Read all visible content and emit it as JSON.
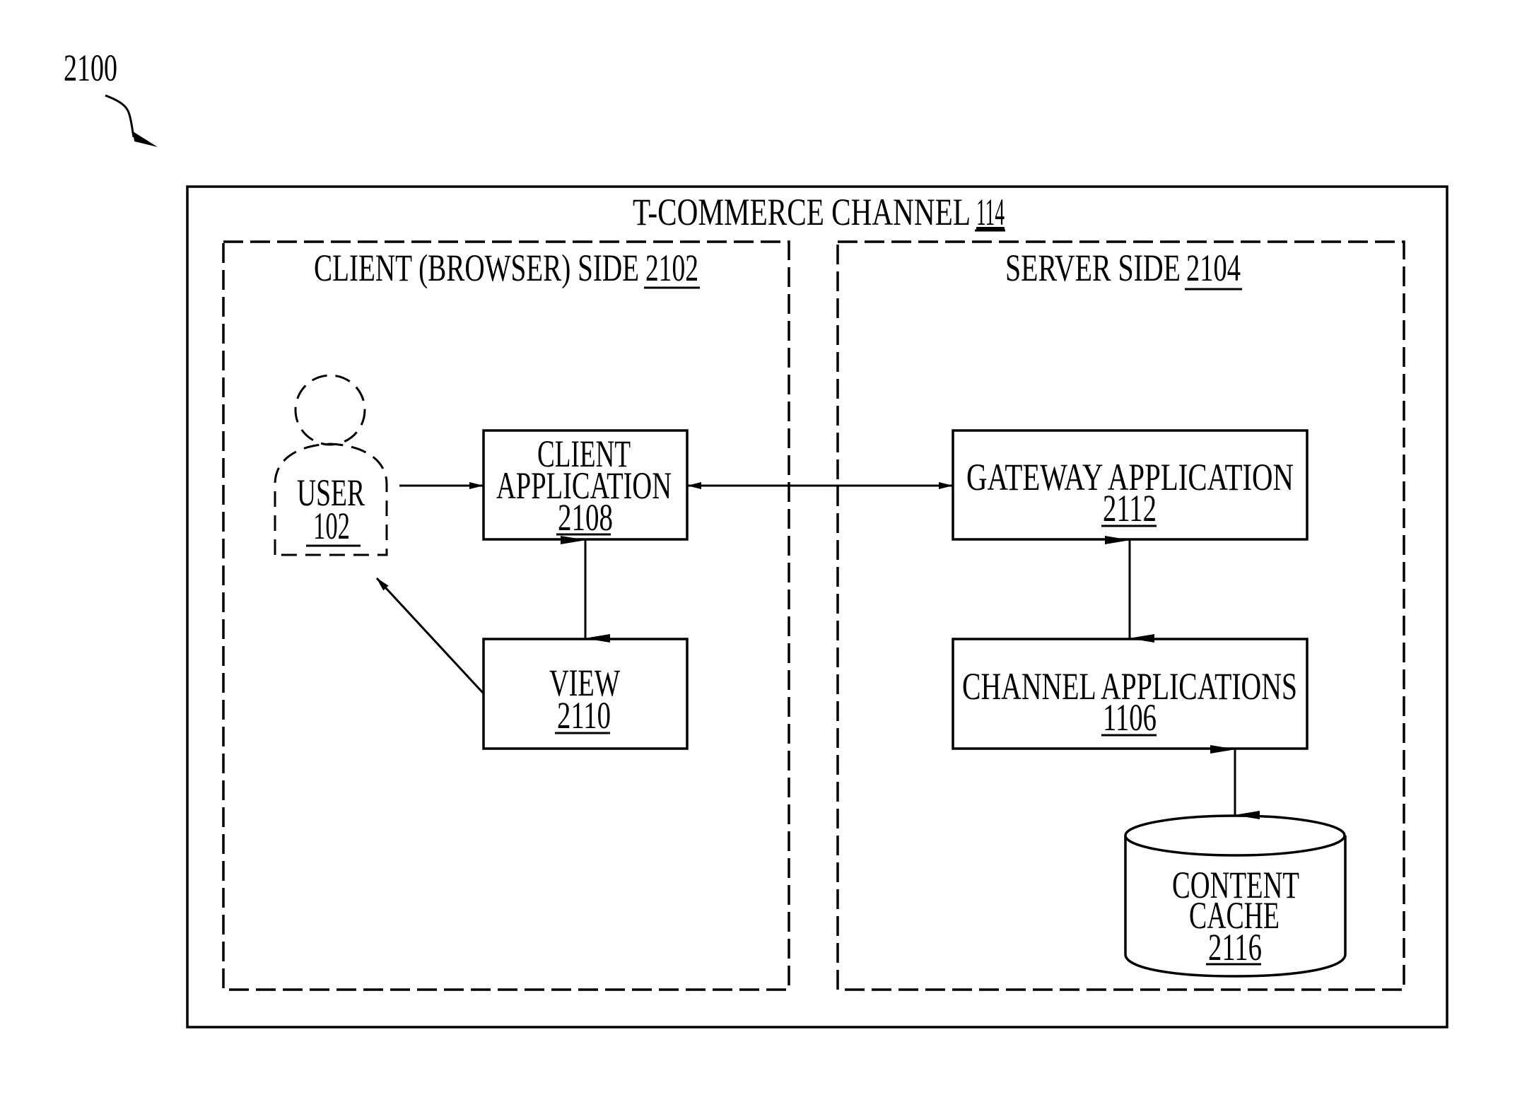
{
  "figure": {
    "ref_number": "2100",
    "ink_color": "#000000",
    "background_color": "#ffffff"
  },
  "channel": {
    "title": "T-COMMERCE CHANNEL",
    "ref": "114"
  },
  "client_side": {
    "title": "CLIENT (BROWSER) SIDE",
    "ref": "2102",
    "user": {
      "label": "USER",
      "ref": "102",
      "icon": "person-icon"
    },
    "client_application": {
      "line1": "CLIENT",
      "line2": "APPLICATION",
      "ref": "2108"
    },
    "view": {
      "label": "VIEW",
      "ref": "2110"
    }
  },
  "server_side": {
    "title": "SERVER SIDE",
    "ref": "2104",
    "gateway_application": {
      "label": "GATEWAY APPLICATION",
      "ref": "2112"
    },
    "channel_applications": {
      "label": "CHANNEL APPLICATIONS",
      "ref": "1106"
    },
    "content_cache": {
      "line1": "CONTENT",
      "line2": "CACHE",
      "ref": "2116",
      "icon": "database-cylinder-icon"
    }
  },
  "connections": [
    {
      "from": "USER 102",
      "to": "CLIENT APPLICATION 2108",
      "direction": "one-way"
    },
    {
      "from": "CLIENT APPLICATION 2108",
      "to": "GATEWAY APPLICATION 2112",
      "direction": "two-way"
    },
    {
      "from": "CLIENT APPLICATION 2108",
      "to": "VIEW 2110",
      "direction": "two-way"
    },
    {
      "from": "VIEW 2110",
      "to": "USER 102",
      "direction": "one-way"
    },
    {
      "from": "GATEWAY APPLICATION 2112",
      "to": "CHANNEL APPLICATIONS 1106",
      "direction": "two-way"
    },
    {
      "from": "CHANNEL APPLICATIONS 1106",
      "to": "CONTENT CACHE 2116",
      "direction": "two-way"
    }
  ]
}
